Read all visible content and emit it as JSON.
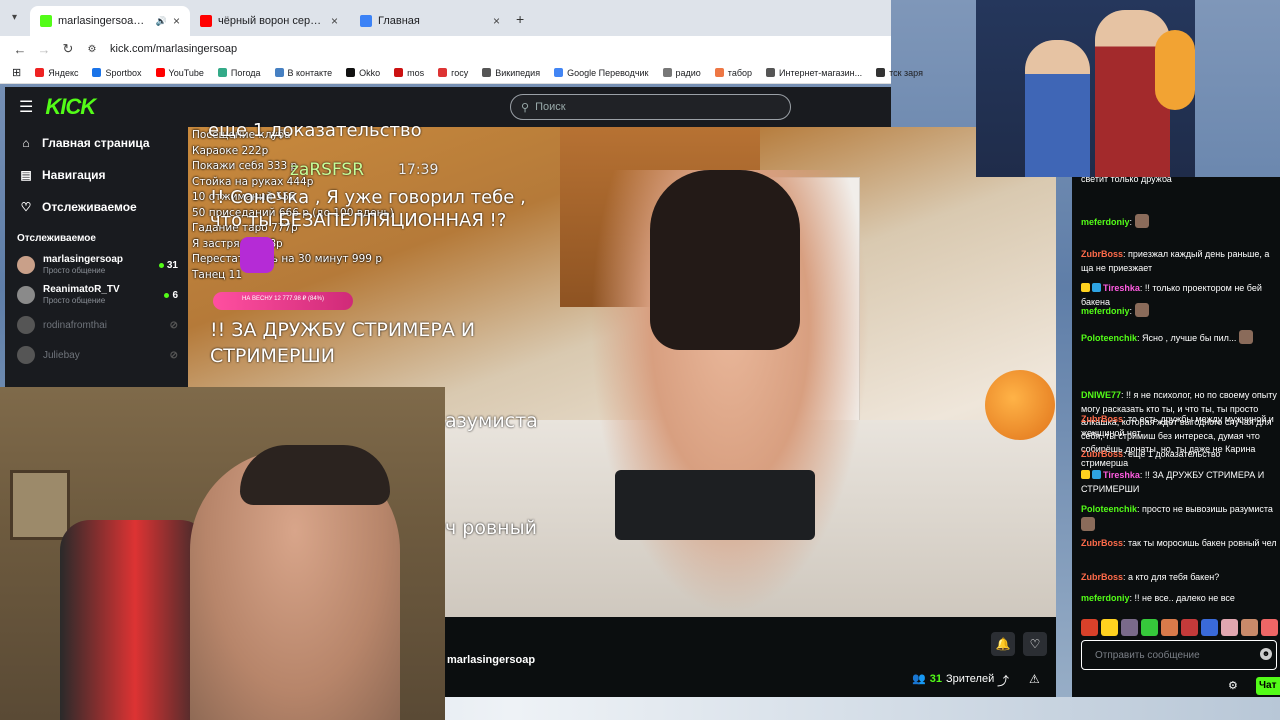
{
  "browser": {
    "tabs": [
      {
        "title": "marlasingersoap Stream - V",
        "active": true,
        "color": "#53fc18"
      },
      {
        "title": "чёрный ворон сериал - YouTu",
        "active": false,
        "color": "#ff0000"
      },
      {
        "title": "Главная",
        "active": false,
        "color": "#3b82f6"
      }
    ],
    "new_tab": "+",
    "url": "kick.com/marlasingersoap",
    "bookmarks": [
      "Яндекс",
      "Sportbox",
      "YouTube",
      "Погода",
      "В контакте",
      "Okko",
      "mos",
      "госу",
      "Википедия",
      "Google Переводчик",
      "радио",
      "табор",
      "Интернет-магазин...",
      "тск заря"
    ]
  },
  "kick": {
    "logo": "KICK",
    "search_placeholder": "Поиск",
    "nav": [
      {
        "label": "Главная страница",
        "icon": "home-icon",
        "glyph": "⌂"
      },
      {
        "label": "Навигация",
        "icon": "browse-icon",
        "glyph": "▤"
      },
      {
        "label": "Отслеживаемое",
        "icon": "heart-icon",
        "glyph": "♡"
      }
    ],
    "following_header": "Отслеживаемое",
    "channels": [
      {
        "name": "marlasingersoap",
        "sub": "Просто общение",
        "viewers": "31",
        "live": true,
        "color": "#c9a089"
      },
      {
        "name": "ReanimatoR_TV",
        "sub": "Просто общение",
        "viewers": "6",
        "live": true,
        "color": "#8a8a8a"
      },
      {
        "name": "rodinafromthai",
        "sub": "",
        "viewers": "",
        "live": false,
        "color": "#555"
      },
      {
        "name": "Juliebay",
        "sub": "",
        "viewers": "",
        "live": false,
        "color": "#555"
      }
    ],
    "accent": "#53fc18"
  },
  "overlay": {
    "lines": [
      "Посещение клуба",
      "Караоке 222р",
      "Покажи себя 333 р",
      "Стойка на руках 444р",
      "10 отжиманий 555",
      "50 приседаний 666 р (до 100 вдень)",
      "Гадание таро 777р",
      "Я застряла 888р",
      "Перестать есть на 30 минут 999 р",
      "Танец 11"
    ],
    "big": "еще 1 доказательство",
    "user": "zaRSFSR",
    "time": "17:39",
    "message": "!! Сонечка , Я уже говорил тебе , что ты БЕЗАПЕЛЛЯЦИОННАЯ !?",
    "donate_label": "НА ВЕСНУ 12 777.98 ₽ (84%)",
    "message2": "!! ЗА ДРУЖБУ СТРИМЕРА И СТРИМЕРШИ",
    "frag1": "азумиста",
    "frag2": "ч ровный"
  },
  "player": {
    "streamer": "marlasingersoap",
    "viewers_count": "31",
    "viewers_label": "Зрителей"
  },
  "chat": {
    "messages": [
      {
        "user": "",
        "color": "#fff",
        "text": "светит только дружба"
      },
      {
        "user": "meferdoniy",
        "color": "#53fc18",
        "text": ":",
        "emote": true
      },
      {
        "user": "ZubrBoss",
        "color": "#ff6b4a",
        "text": ": приезжал каждый день раньше, а ща не приезжает"
      },
      {
        "user": "Tireshka",
        "color": "#ff5ce1",
        "text": ": !! только проектором не бей бакена",
        "badges": true
      },
      {
        "user": "meferdoniy",
        "color": "#53fc18",
        "text": ":",
        "emote": true
      },
      {
        "user": "Poloteenchik",
        "color": "#53fc18",
        "text": ": Ясно , лучше бы пил...",
        "emote": true
      },
      {
        "user": "DNIWE77",
        "color": "#53fc18",
        "text": ": !! я не психолог, но по своему опыту могу расказать кто ты, и что ты, ты просто алкашка, которая ждёт выгодного случая для себя, ты стримиш без интереса, думая что собирёшь донаты, но, ты даже не Карина стримерша"
      },
      {
        "user": "ZubrBoss",
        "color": "#ff6b4a",
        "text": ": то есть дружбы между мужчиной и женщиной нет"
      },
      {
        "user": "ZubrBoss",
        "color": "#ff6b4a",
        "text": ": еще 1 доказательство"
      },
      {
        "user": "Tireshka",
        "color": "#ff5ce1",
        "text": ": !! ЗА ДРУЖБУ СТРИМЕРА И СТРИМЕРШИ",
        "badges": true
      },
      {
        "user": "Poloteenchik",
        "color": "#53fc18",
        "text": ": просто не вывозишь разумиста",
        "emote": true
      },
      {
        "user": "ZubrBoss",
        "color": "#ff6b4a",
        "text": ": так ты моросишь бакен ровный чел"
      },
      {
        "user": "ZubrBoss",
        "color": "#ff6b4a",
        "text": ": а кто для тебя бакен?"
      },
      {
        "user": "meferdoniy",
        "color": "#53fc18",
        "text": ": !! не все.. далеко не все"
      }
    ],
    "emotes": [
      "#d9412a",
      "#ffd21f",
      "#7a6a8a",
      "#36c93b",
      "#d97a4a",
      "#c43a3a",
      "#3a6ad9",
      "#e1a6b0",
      "#c98a6a",
      "#e66"
    ],
    "input_placeholder": "Отправить сообщение",
    "chat_button": "Чат"
  }
}
